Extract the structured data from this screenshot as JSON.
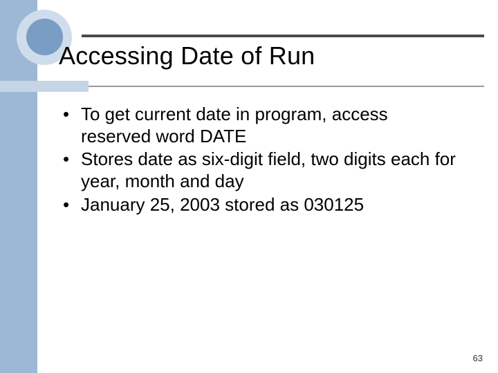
{
  "slide": {
    "title": "Accessing Date of Run",
    "bullets": [
      "To get current date in program, access reserved word DATE",
      "Stores date as six-digit field, two digits each for year, month and day",
      "January 25, 2003 stored as 030125"
    ],
    "page_number": "63"
  }
}
